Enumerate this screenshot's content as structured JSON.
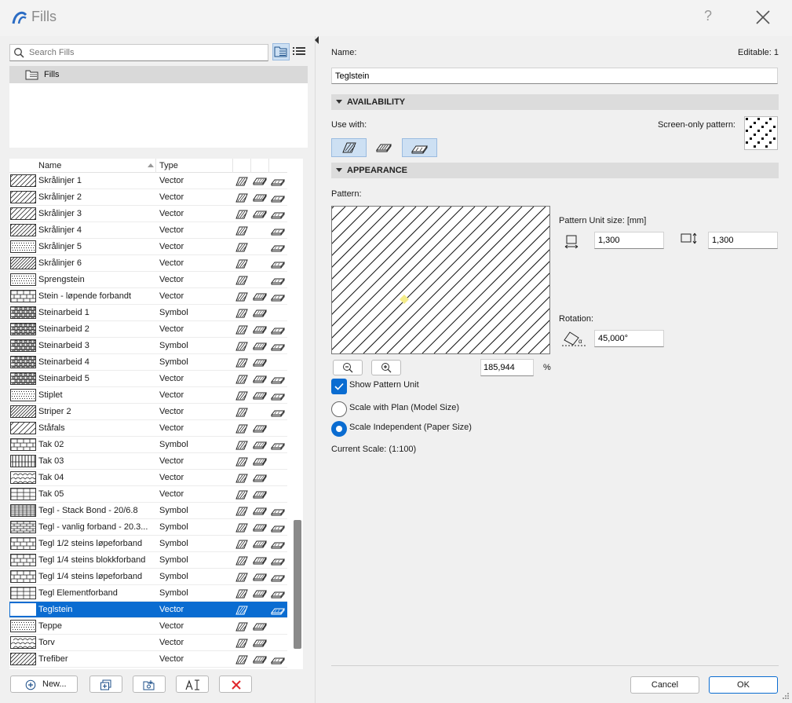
{
  "window": {
    "title": "Fills",
    "help": "?"
  },
  "search": {
    "placeholder": "Search Fills",
    "value": ""
  },
  "tree": {
    "root_label": "Fills"
  },
  "list": {
    "headers": {
      "name": "Name",
      "type": "Type"
    },
    "rows": [
      {
        "name": "Skrålinjer 1",
        "type": "Vector",
        "pattern": "diag-sparse",
        "uses": [
          1,
          1,
          1
        ],
        "selected": false
      },
      {
        "name": "Skrålinjer 2",
        "type": "Vector",
        "pattern": "diag-sparse",
        "uses": [
          1,
          1,
          1
        ],
        "selected": false
      },
      {
        "name": "Skrålinjer 3",
        "type": "Vector",
        "pattern": "diag-sparse",
        "uses": [
          1,
          1,
          1
        ],
        "selected": false
      },
      {
        "name": "Skrålinjer 4",
        "type": "Vector",
        "pattern": "diag-medium",
        "uses": [
          1,
          0,
          1
        ],
        "selected": false
      },
      {
        "name": "Skrålinjer 5",
        "type": "Vector",
        "pattern": "dots",
        "uses": [
          1,
          0,
          1
        ],
        "selected": false
      },
      {
        "name": "Skrålinjer 6",
        "type": "Vector",
        "pattern": "diag-dense",
        "uses": [
          1,
          0,
          1
        ],
        "selected": false
      },
      {
        "name": "Sprengstein",
        "type": "Vector",
        "pattern": "dots",
        "uses": [
          1,
          0,
          1
        ],
        "selected": false
      },
      {
        "name": "Stein - løpende forbandt",
        "type": "Vector",
        "pattern": "brick",
        "uses": [
          1,
          1,
          1
        ],
        "selected": false
      },
      {
        "name": "Steinarbeid 1",
        "type": "Symbol",
        "pattern": "stone",
        "uses": [
          1,
          1,
          0
        ],
        "selected": false
      },
      {
        "name": "Steinarbeid 2",
        "type": "Vector",
        "pattern": "stone",
        "uses": [
          1,
          1,
          1
        ],
        "selected": false
      },
      {
        "name": "Steinarbeid 3",
        "type": "Symbol",
        "pattern": "stone",
        "uses": [
          1,
          1,
          1
        ],
        "selected": false
      },
      {
        "name": "Steinarbeid 4",
        "type": "Symbol",
        "pattern": "stone",
        "uses": [
          1,
          1,
          0
        ],
        "selected": false
      },
      {
        "name": "Steinarbeid 5",
        "type": "Vector",
        "pattern": "stone",
        "uses": [
          1,
          1,
          1
        ],
        "selected": false
      },
      {
        "name": "Stiplet",
        "type": "Vector",
        "pattern": "dots",
        "uses": [
          1,
          1,
          1
        ],
        "selected": false
      },
      {
        "name": "Striper 2",
        "type": "Vector",
        "pattern": "diag-dense",
        "uses": [
          1,
          0,
          1
        ],
        "selected": false
      },
      {
        "name": "Ståfals",
        "type": "Vector",
        "pattern": "diag-wide",
        "uses": [
          1,
          1,
          0
        ],
        "selected": false
      },
      {
        "name": "Tak 02",
        "type": "Symbol",
        "pattern": "brick",
        "uses": [
          1,
          1,
          1
        ],
        "selected": false
      },
      {
        "name": "Tak 03",
        "type": "Vector",
        "pattern": "vert",
        "uses": [
          1,
          1,
          0
        ],
        "selected": false
      },
      {
        "name": "Tak 04",
        "type": "Vector",
        "pattern": "scales",
        "uses": [
          1,
          1,
          0
        ],
        "selected": false
      },
      {
        "name": "Tak 05",
        "type": "Vector",
        "pattern": "grid",
        "uses": [
          1,
          1,
          0
        ],
        "selected": false
      },
      {
        "name": "Tegl - Stack Bond - 20/6.8",
        "type": "Symbol",
        "pattern": "grid-dense",
        "uses": [
          1,
          1,
          1
        ],
        "selected": false
      },
      {
        "name": "Tegl - vanlig forband - 20.3...",
        "type": "Symbol",
        "pattern": "brick-dense",
        "uses": [
          1,
          1,
          1
        ],
        "selected": false
      },
      {
        "name": "Tegl 1/2 steins løpeforband",
        "type": "Symbol",
        "pattern": "brick",
        "uses": [
          1,
          1,
          1
        ],
        "selected": false
      },
      {
        "name": "Tegl 1/4 steins blokkforband",
        "type": "Symbol",
        "pattern": "brick",
        "uses": [
          1,
          1,
          1
        ],
        "selected": false
      },
      {
        "name": "Tegl 1/4 steins løpeforband",
        "type": "Symbol",
        "pattern": "brick",
        "uses": [
          1,
          1,
          1
        ],
        "selected": false
      },
      {
        "name": "Tegl Elementforband",
        "type": "Symbol",
        "pattern": "grid",
        "uses": [
          1,
          1,
          1
        ],
        "selected": false
      },
      {
        "name": "Teglstein",
        "type": "Vector",
        "pattern": "diag-sparse",
        "uses": [
          1,
          0,
          1
        ],
        "selected": true
      },
      {
        "name": "Teppe",
        "type": "Vector",
        "pattern": "dots",
        "uses": [
          1,
          1,
          0
        ],
        "selected": false
      },
      {
        "name": "Torv",
        "type": "Vector",
        "pattern": "scales",
        "uses": [
          1,
          1,
          0
        ],
        "selected": false
      },
      {
        "name": "Trefiber",
        "type": "Vector",
        "pattern": "diag-medium",
        "uses": [
          1,
          1,
          1
        ],
        "selected": false
      }
    ]
  },
  "bottom": {
    "new_label": "New..."
  },
  "settings": {
    "name_label": "Name:",
    "editable_label": "Editable: 1",
    "name_value": "Teglstein",
    "availability": "AVAILABILITY",
    "use_with": "Use with:",
    "screen_only": "Screen-only pattern:",
    "appearance": "APPEARANCE",
    "pattern_label": "Pattern:",
    "unit_size_label": "Pattern Unit size: [mm]",
    "unit_width": "1,300",
    "unit_height": "1,300",
    "rotation_label": "Rotation:",
    "rotation_value": "45,000°",
    "zoom_value": "185,944",
    "zoom_unit": "%",
    "show_pattern_unit": "Show Pattern Unit",
    "show_pattern_unit_checked": true,
    "scale_with_plan": "Scale with Plan (Model Size)",
    "scale_independent": "Scale Independent (Paper Size)",
    "scale_mode": "independent",
    "current_scale": "Current Scale: (1:100)"
  },
  "dialog": {
    "cancel": "Cancel",
    "ok": "OK"
  },
  "colors": {
    "accent": "#0a6cd1",
    "toggle_on": "#cde0f3"
  }
}
